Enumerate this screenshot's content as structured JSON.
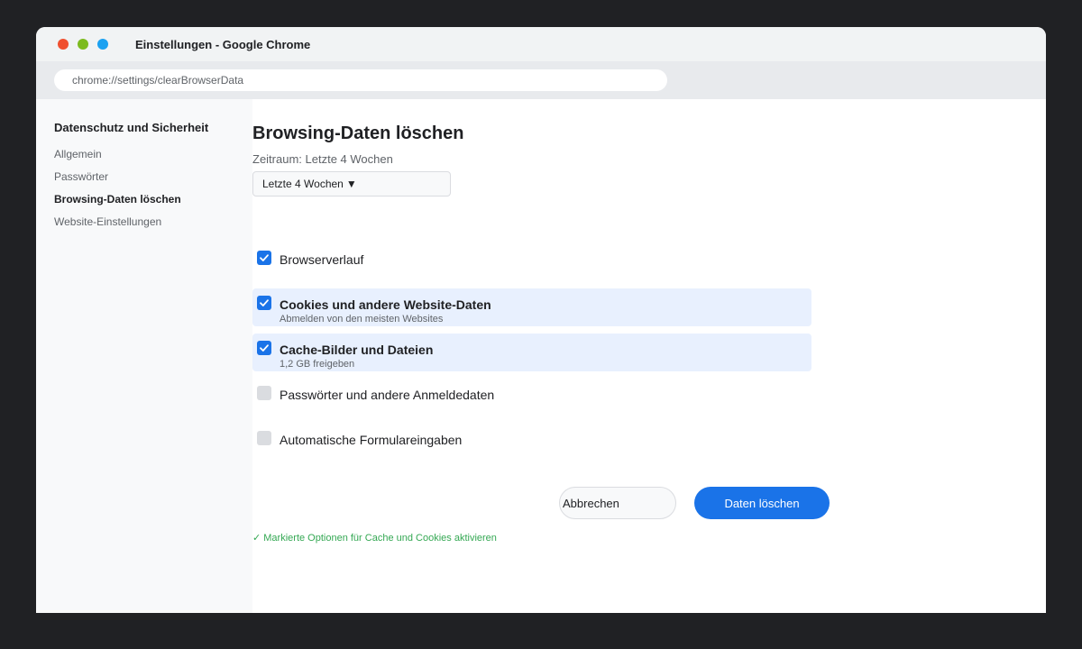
{
  "window": {
    "title": "Einstellungen - Google Chrome",
    "url": "chrome://settings/clearBrowserData"
  },
  "sidebar": {
    "title": "Datenschutz und Sicherheit",
    "items": [
      {
        "label": "Allgemein",
        "active": false
      },
      {
        "label": "Passwörter",
        "active": false
      },
      {
        "label": "Browsing-Daten löschen",
        "active": true
      },
      {
        "label": "Website-Einstellungen",
        "active": false
      }
    ]
  },
  "main": {
    "heading": "Browsing-Daten löschen",
    "timerange_label": "Zeitraum: Letzte 4 Wochen",
    "timerange_select": "Letzte 4 Wochen",
    "caret_glyph": "▼",
    "options": [
      {
        "label": "Browserverlauf",
        "sub": "",
        "checked": true,
        "highlighted": false
      },
      {
        "label": "Cookies und andere Website-Daten",
        "sub": "Abmelden von den meisten Websites",
        "checked": true,
        "highlighted": true
      },
      {
        "label": "Cache-Bilder und Dateien",
        "sub": "1,2 GB freigeben",
        "checked": true,
        "highlighted": true
      },
      {
        "label": "Passwörter und andere Anmeldedaten",
        "sub": "",
        "checked": false,
        "highlighted": false
      },
      {
        "label": "Automatische Formulareingaben",
        "sub": "",
        "checked": false,
        "highlighted": false
      }
    ],
    "cancel_label": "Abbrechen",
    "confirm_label": "Daten löschen",
    "hint": "✓ Markierte Optionen für Cache und Cookies aktivieren"
  },
  "colors": {
    "accent": "#1a73e8",
    "highlight": "#e8f0fe",
    "success": "#34a853"
  }
}
